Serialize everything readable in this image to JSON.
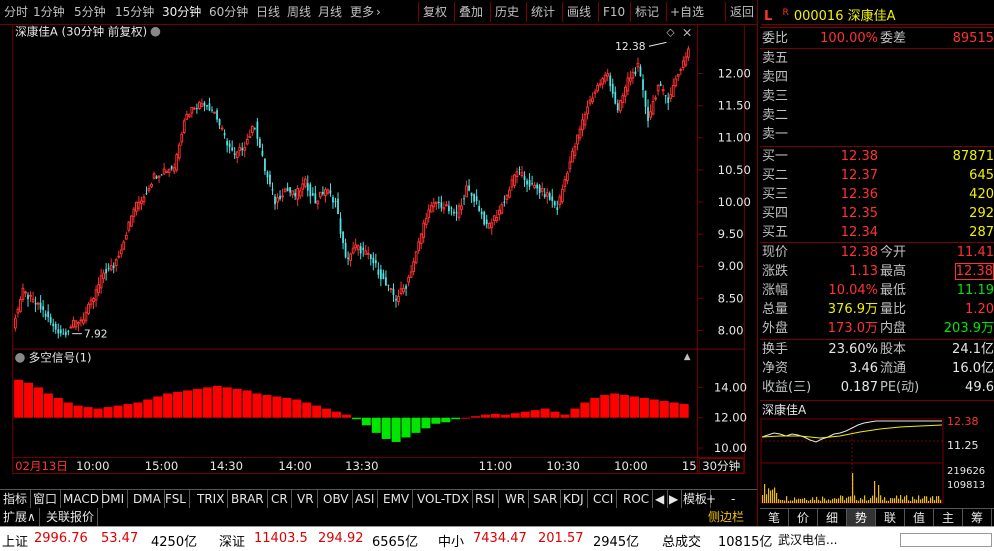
{
  "toolbar": {
    "periods": [
      "分时",
      "1分钟",
      "5分钟",
      "15分钟",
      "30分钟",
      "60分钟",
      "日线",
      "周线",
      "月线",
      "更多"
    ],
    "active_period": "30分钟",
    "more_arrow": "›",
    "tools": [
      "复权",
      "叠加",
      "历史",
      "统计",
      "画线",
      "F10",
      "标记",
      "+自选",
      "返回"
    ]
  },
  "chart_header": {
    "title": "深康佳A (30分钟 前复权)",
    "marker": "◇",
    "close": "×"
  },
  "indicator_header": {
    "title": "多空信号(1)",
    "scroll_up": "▲"
  },
  "price_axis": {
    "labels": [
      "12.00",
      "11.50",
      "11.00",
      "10.50",
      "10.00",
      "9.50",
      "9.00",
      "8.50",
      "8.00"
    ],
    "high_label": "12.38",
    "low_label": "7.92"
  },
  "indicator_axis": {
    "labels": [
      "14.00",
      "12.00",
      "10.00"
    ]
  },
  "time_axis": {
    "labels": [
      "02月13日",
      "10:00",
      "15:00",
      "14:30",
      "14:00",
      "13:30",
      "11:00",
      "10:30",
      "10:00",
      "15"
    ],
    "period_btn": "30分钟"
  },
  "stock": {
    "flag_l": "L",
    "flag_r": "R",
    "code": "000016",
    "name": "深康佳A"
  },
  "commission": {
    "ratio_label": "委比",
    "ratio": "100.00%",
    "diff_label": "委差",
    "diff": "89515"
  },
  "asks": [
    {
      "label": "卖五",
      "price": "",
      "vol": ""
    },
    {
      "label": "卖四",
      "price": "",
      "vol": ""
    },
    {
      "label": "卖三",
      "price": "",
      "vol": ""
    },
    {
      "label": "卖二",
      "price": "",
      "vol": ""
    },
    {
      "label": "卖一",
      "price": "",
      "vol": ""
    }
  ],
  "bids": [
    {
      "label": "买一",
      "price": "12.38",
      "vol": "87871"
    },
    {
      "label": "买二",
      "price": "12.37",
      "vol": "645"
    },
    {
      "label": "买三",
      "price": "12.36",
      "vol": "420"
    },
    {
      "label": "买四",
      "price": "12.35",
      "vol": "292"
    },
    {
      "label": "买五",
      "price": "12.34",
      "vol": "287"
    }
  ],
  "quote": [
    {
      "l1": "现价",
      "v1": "12.38",
      "l2": "今开",
      "v2": "11.41"
    },
    {
      "l1": "涨跌",
      "v1": "1.13",
      "l2": "最高",
      "v2": "12.38"
    },
    {
      "l1": "涨幅",
      "v1": "10.04%",
      "l2": "最低",
      "v2": "11.19"
    },
    {
      "l1": "总量",
      "v1": "376.9万",
      "l2": "量比",
      "v2": "1.20"
    },
    {
      "l1": "外盘",
      "v1": "173.0万",
      "l2": "内盘",
      "v2": "203.9万"
    }
  ],
  "fundamentals": [
    {
      "l1": "换手",
      "v1": "23.60%",
      "l2": "股本",
      "v2": "24.1亿"
    },
    {
      "l1": "净资",
      "v1": "3.46",
      "l2": "流通",
      "v2": "16.0亿"
    },
    {
      "l1": "收益(三)",
      "v1": "0.187",
      "l2": "PE(动)",
      "v2": "49.6"
    }
  ],
  "mini_chart": {
    "title": "深康佳A",
    "price_high": "12.38",
    "price_low": "11.25",
    "vol_high": "219626",
    "vol_low": "109813"
  },
  "bottom_tabs": [
    "指标",
    "窗口",
    "MACD",
    "DMI",
    "DMA",
    "FSL",
    "TRIX",
    "BRAR",
    "CR",
    "VR",
    "OBV",
    "ASI",
    "EMV",
    "VOL-TDX",
    "RSI",
    "WR",
    "SAR",
    "KDJ",
    "CCI",
    "ROC",
    "◀",
    "▶",
    "模板"
  ],
  "bottom_tabs2": [
    "扩展∧",
    "关联报价"
  ],
  "sub_controls": [
    "+",
    "-"
  ],
  "side_bar": {
    "label": "侧边栏 ◀",
    "tabs": [
      "笔",
      "价",
      "细",
      "势",
      "联",
      "值",
      "主",
      "筹"
    ],
    "active": "势"
  },
  "status_bar": [
    {
      "name": "上证",
      "v1": "2996.76",
      "v2": "53.47",
      "v3": "4250亿"
    },
    {
      "name": "深证",
      "v1": "11403.5",
      "v2": "294.92",
      "v3": "6565亿"
    },
    {
      "name": "中小",
      "v1": "7434.47",
      "v2": "201.57",
      "v3": "2945亿"
    }
  ],
  "status_total": {
    "label": "总成交",
    "value": "10815亿",
    "news": "武汉电信..."
  },
  "colors": {
    "up": "#ff3232",
    "down": "#50e6e6",
    "bg": "#000000",
    "grid": "#7a0000",
    "ind_down": "#00e600"
  },
  "chart_data": {
    "type": "candlestick",
    "title": "深康佳A (30分钟 前复权)",
    "ylim": [
      7.8,
      12.5
    ],
    "y_ticks": [
      8.0,
      8.5,
      9.0,
      9.5,
      10.0,
      10.5,
      11.0,
      11.5,
      12.0
    ],
    "high": 12.38,
    "low": 7.92,
    "close_path": [
      8.1,
      8.6,
      8.45,
      8.3,
      8.05,
      7.95,
      8.1,
      8.2,
      8.5,
      8.9,
      9.0,
      9.4,
      9.9,
      10.1,
      10.4,
      10.5,
      10.55,
      11.3,
      11.5,
      11.55,
      11.4,
      11.0,
      10.7,
      10.9,
      11.2,
      10.5,
      10.0,
      10.2,
      10.1,
      10.3,
      10.0,
      10.2,
      10.0,
      9.1,
      9.3,
      9.2,
      9.0,
      8.7,
      8.5,
      8.7,
      9.2,
      9.8,
      10.0,
      9.9,
      9.8,
      10.2,
      10.0,
      9.6,
      9.8,
      10.1,
      10.5,
      10.3,
      10.2,
      10.1,
      9.9,
      10.5,
      11.0,
      11.5,
      11.8,
      12.0,
      11.4,
      11.9,
      12.1,
      11.3,
      11.8,
      11.6,
      12.0,
      12.38
    ],
    "indicator": {
      "name": "多空信号",
      "ylim": [
        9.5,
        15.5
      ],
      "y_ticks": [
        10.0,
        12.0,
        14.0
      ],
      "baseline": 12.0,
      "bars": [
        14.5,
        14.3,
        14.0,
        13.6,
        13.3,
        13.0,
        12.8,
        12.7,
        12.6,
        12.7,
        12.8,
        12.9,
        13.0,
        13.2,
        13.4,
        13.6,
        13.7,
        13.8,
        13.9,
        14.0,
        14.1,
        14.0,
        13.9,
        13.8,
        13.6,
        13.5,
        13.4,
        13.3,
        13.2,
        13.0,
        12.8,
        12.6,
        12.4,
        12.2,
        11.9,
        11.5,
        11.0,
        10.6,
        10.4,
        10.7,
        11.0,
        11.3,
        11.6,
        11.7,
        11.9,
        12.0,
        12.1,
        12.2,
        12.25,
        12.2,
        12.3,
        12.4,
        12.5,
        12.6,
        12.4,
        12.2,
        12.6,
        13.0,
        13.3,
        13.5,
        13.6,
        13.5,
        13.4,
        13.3,
        13.2,
        13.1,
        13.0,
        12.9
      ]
    }
  }
}
